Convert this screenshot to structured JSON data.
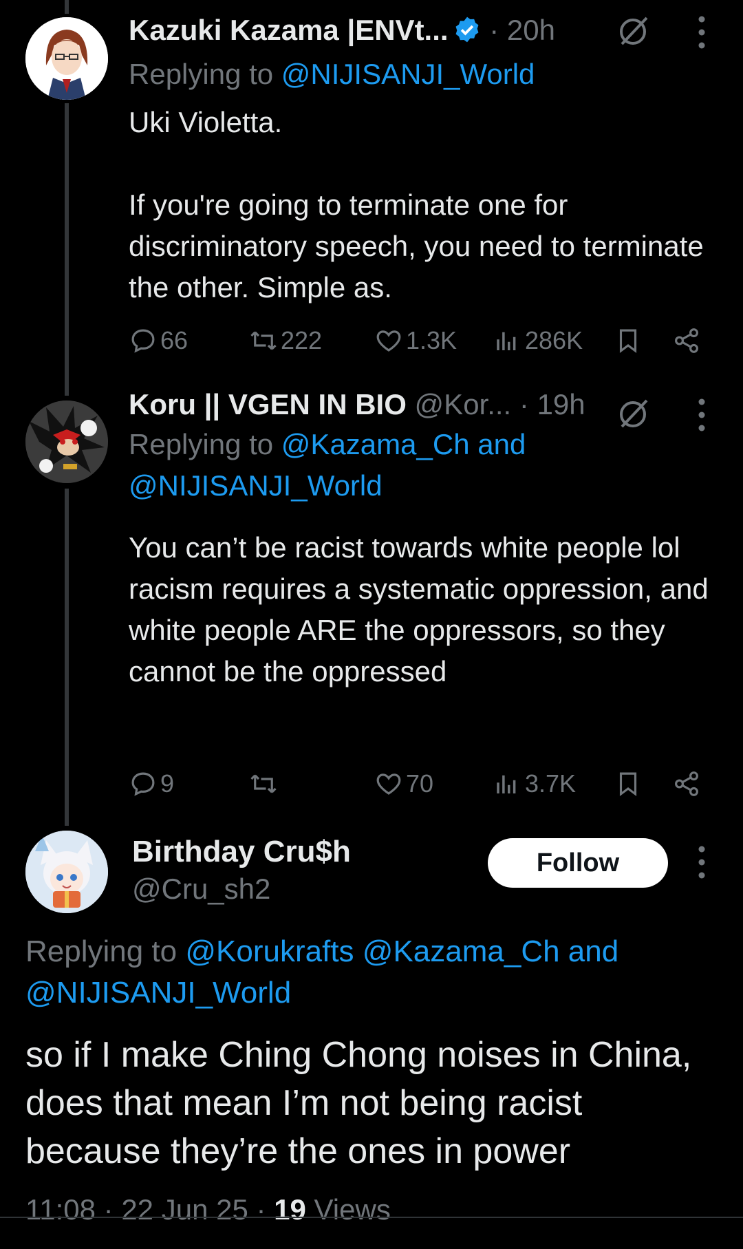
{
  "tweets": [
    {
      "name": "Kazuki Kazama |ENVt...",
      "handle": "",
      "time": "20h",
      "replying_label": "Replying to",
      "replying_to": "@NIJISANJI_World",
      "body_line1": "Uki Violetta.",
      "body_line2": "If you're going to terminate one for discriminatory speech, you need to terminate the other. Simple as.",
      "stats": {
        "replies": "66",
        "reposts": "222",
        "likes": "1.3K",
        "views": "286K"
      }
    },
    {
      "name": "Koru || VGEN IN BIO",
      "handle": "@Kor...",
      "time": "19h",
      "replying_label": "Replying to",
      "replying_to": "@Kazama_Ch and @NIJISANJI_World",
      "body": "You can’t be racist towards white people lol racism requires a systematic oppression, and white people ARE the oppressors, so they cannot be the oppressed",
      "stats": {
        "replies": "9",
        "reposts": "",
        "likes": "70",
        "views": "3.7K"
      }
    }
  ],
  "main": {
    "name": "Birthday Cru$h",
    "handle": "@Cru_sh2",
    "follow_label": "Follow",
    "replying_label": "Replying to",
    "replying_to": "@Korukrafts @Kazama_Ch and @NIJISANJI_World",
    "body": "so if I make Ching Chong noises in China, does that mean I’m not being racist because they’re the ones in power",
    "time": "11:08",
    "date": "22 Jun 25",
    "views_count": "19",
    "views_label": "Views"
  },
  "colors": {
    "background": "#000000",
    "text": "#e7e9ea",
    "muted": "#71767b",
    "link": "#1d9bf0",
    "verified": "#1d9bf0"
  }
}
